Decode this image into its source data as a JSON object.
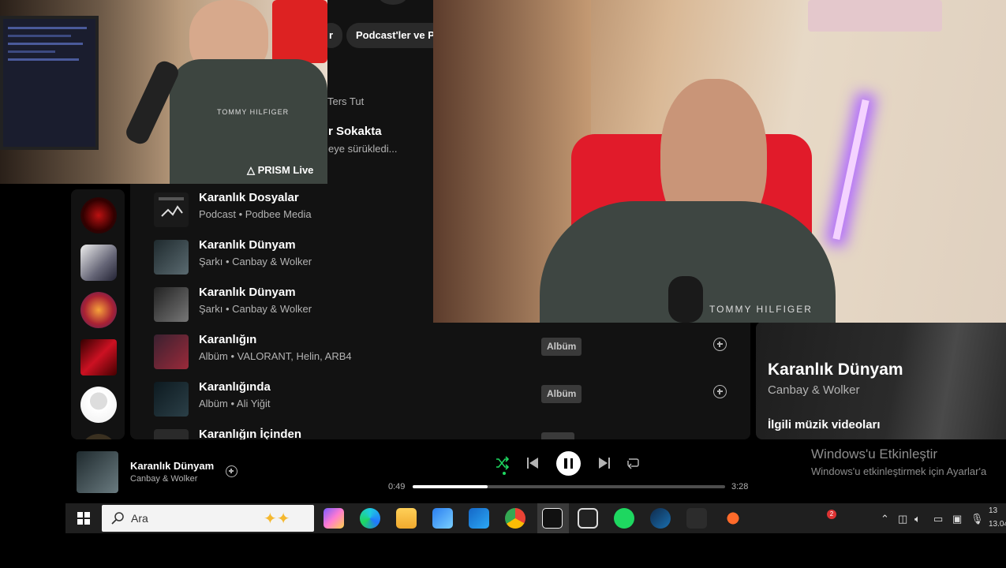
{
  "spotify": {
    "chips": [
      "r",
      "Podcast'ler ve Pr"
    ],
    "partial_results": [
      {
        "title": "",
        "subtitle": "Ters Tut"
      },
      {
        "title": "r Sokakta",
        "subtitle": "eye sürükledi..."
      }
    ],
    "results": [
      {
        "title": "Karanlık Dosyalar",
        "subtitle": "Podcast • Podbee Media",
        "badge": ""
      },
      {
        "title": "Karanlık Dünyam",
        "subtitle": "Şarkı • Canbay & Wolker",
        "badge": ""
      },
      {
        "title": "Karanlık Dünyam",
        "subtitle": "Şarkı • Canbay & Wolker",
        "badge": ""
      },
      {
        "title": "Karanlığın",
        "subtitle": "Albüm • VALORANT, Helin, ARB4",
        "badge": "Albüm"
      },
      {
        "title": "Karanlığında",
        "subtitle": "Albüm • Ali Yiğit",
        "badge": "Albüm"
      },
      {
        "title": "Karanlığın İçinden",
        "subtitle": "",
        "badge": ""
      }
    ],
    "now_playing_panel": {
      "title": "Karanlık Dünyam",
      "artist": "Canbay & Wolker",
      "related": "İlgili müzik videoları"
    },
    "player": {
      "track": "Karanlık Dünyam",
      "artist": "Canbay & Wolker",
      "elapsed": "0:49",
      "duration": "3:28",
      "progress": 0.24
    }
  },
  "overlay": {
    "cam_label": "PRISM Live",
    "shirt_text": "TOMMY HILFIGER",
    "activation_title": "Windows'u Etkinleştir",
    "activation_sub": "Windows'u etkinleştirmek için Ayarlar'a"
  },
  "taskbar": {
    "search_placeholder": "Ara",
    "notification_count": "2",
    "clock_time": "13",
    "clock_date": "13.04"
  },
  "colors": {
    "accent": "#1ed760",
    "spotify_bg": "#121212",
    "taskbar_bg": "#1f1f1f"
  }
}
